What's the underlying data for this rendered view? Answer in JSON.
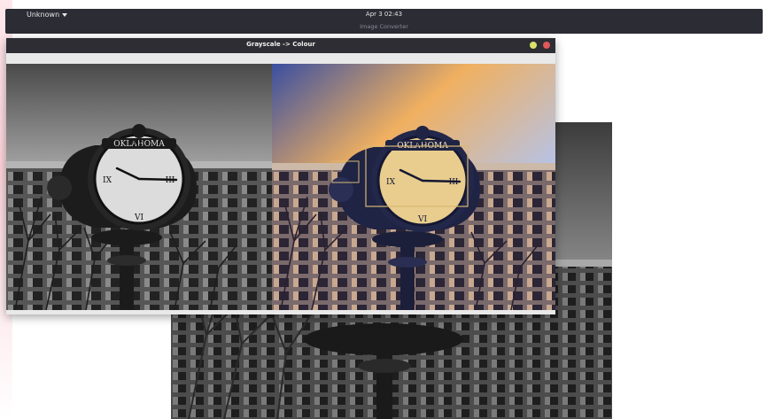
{
  "top_bar": {
    "menu_label": "Unknown",
    "clock": "Apr 3  02:43",
    "app_name": "Image Converter"
  },
  "window": {
    "title": "Grayscale -> Colour"
  },
  "images": {
    "clock_sign": "OKLAHOMA"
  },
  "colors": {
    "top_bar": "#2b2c34",
    "title_bar": "#2d2d33",
    "minimize": "#d9e36a",
    "close": "#e0585a",
    "sky_blue": "#5a6fb6",
    "sky_orange": "#f0b060"
  },
  "icons": {
    "menu": "chevron-down-icon",
    "minimize": "minimize-icon",
    "close": "close-icon"
  }
}
